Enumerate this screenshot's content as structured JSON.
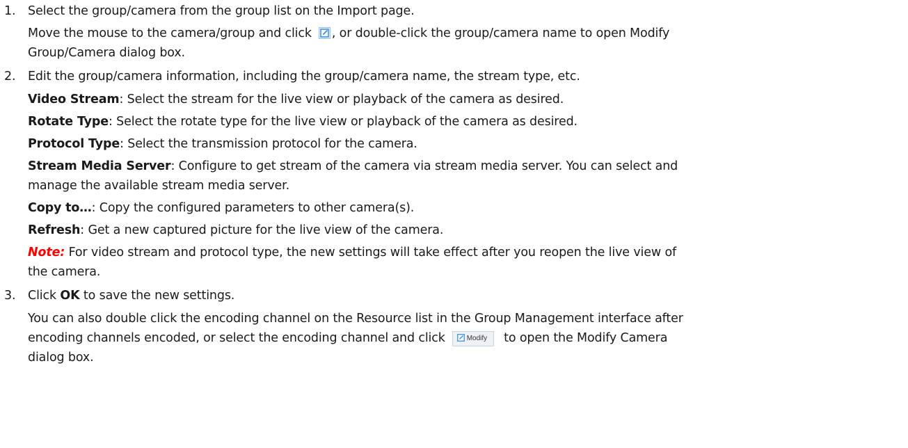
{
  "steps": [
    {
      "number": "1.",
      "text": "Select the group/camera from the group list on the Import page.",
      "detail_part1": "Move the mouse to the camera/group and click",
      "detail_part2": ", or double-click the group/camera name to open Modify",
      "detail_line2": "Group/Camera dialog box.",
      "icon": "edit-icon"
    },
    {
      "number": "2.",
      "text": "Edit the group/camera information, including the group/camera name, the stream type, etc.",
      "definitions": [
        {
          "term": "Video Stream",
          "desc": ": Select the stream for the live view or playback of the camera as desired."
        },
        {
          "term": "Rotate Type",
          "desc": ": Select the rotate type for the live view or playback of the camera as desired."
        },
        {
          "term": "Protocol Type",
          "desc": ": Select the transmission protocol for the camera."
        },
        {
          "term": "Stream Media Server",
          "desc": ": Configure to get stream of the camera via stream media server. You can select and",
          "desc2": "manage the available stream media server."
        },
        {
          "term": "Copy to…",
          "desc": ": Copy the configured parameters to other camera(s)."
        },
        {
          "term": "Refresh",
          "desc": ": Get a new captured picture for the live view of the camera."
        }
      ],
      "note_label": "Note",
      "note_colon": ":",
      "note_text": " For video stream and protocol type, the new settings will take effect after you reopen the live view of",
      "note_text2": "the camera."
    },
    {
      "number": "3.",
      "text_before": "Click ",
      "text_bold": "OK",
      "text_after": " to save the new settings.",
      "extra_line1": "You can also double click the encoding channel on the Resource list in the Group Management interface after",
      "extra_line2_part1": "encoding channels encoded, or select the encoding channel and click",
      "button_label": "Modify",
      "extra_line2_part2": "to open the Modify Camera",
      "extra_line3": "dialog box."
    }
  ],
  "colors": {
    "text": "#1a1a1a",
    "note": "#ff0000",
    "icon_blue": "#3a8ee6"
  }
}
